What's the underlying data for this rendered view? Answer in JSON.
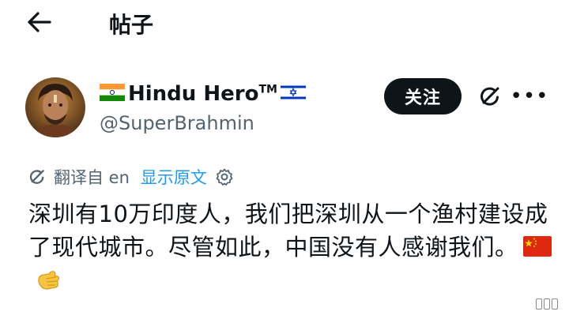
{
  "header": {
    "title": "帖子",
    "back_icon": "arrow-left-icon"
  },
  "author": {
    "display_name": "Hindu Hero",
    "trademark": "TM",
    "handle": "@SuperBrahmin",
    "name_prefix_icon": "india-flag-icon",
    "name_suffix_icon": "israel-flag-icon"
  },
  "actions": {
    "follow_label": "关注",
    "grok_icon": "grok-icon",
    "more_label": "•••"
  },
  "translation": {
    "translated_from": "翻译自 en",
    "show_original": "显示原文",
    "settings_icon": "gear-icon"
  },
  "post": {
    "text": "深圳有10万印度人，我们把深圳从一个渔村建设成了现代城市。尽管如此，中国没有人感谢我们。",
    "emojis": [
      "china-flag-icon",
      "pointing-hand-icon"
    ]
  },
  "colors": {
    "text": "#0f1419",
    "muted": "#536471",
    "link": "#1d9bf0",
    "follow_bg": "#0f1419"
  }
}
